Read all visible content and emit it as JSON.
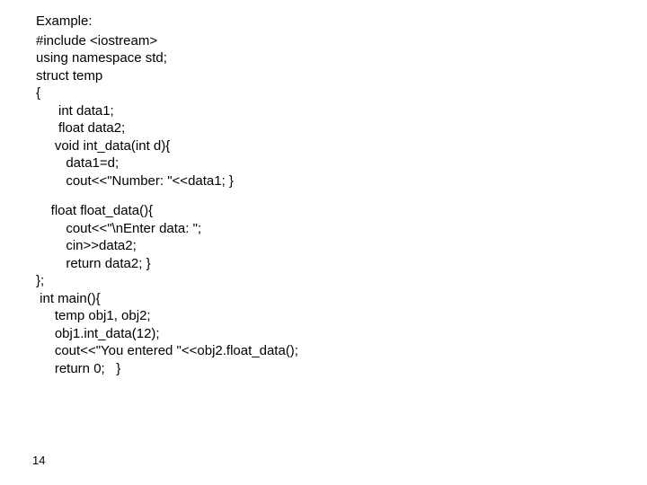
{
  "heading": "Example:",
  "code": {
    "l1": "#include <iostream>",
    "l2": "using namespace std;",
    "l3": "struct temp",
    "l4": "{",
    "l5": "      int data1;",
    "l6": "      float data2;",
    "l7": "     void int_data(int d){",
    "l8": "        data1=d;",
    "l9": "        cout<<\"Number: \"<<data1; }",
    "l10": "    float float_data(){",
    "l11": "        cout<<\"\\nEnter data: \";",
    "l12": "        cin>>data2;",
    "l13": "        return data2; }",
    "l14": "};",
    "l15": " int main(){",
    "l16": "     temp obj1, obj2;",
    "l17": "     obj1.int_data(12);",
    "l18": "     cout<<\"You entered \"<<obj2.float_data();",
    "l19": "     return 0;   }"
  },
  "page_number": "14"
}
